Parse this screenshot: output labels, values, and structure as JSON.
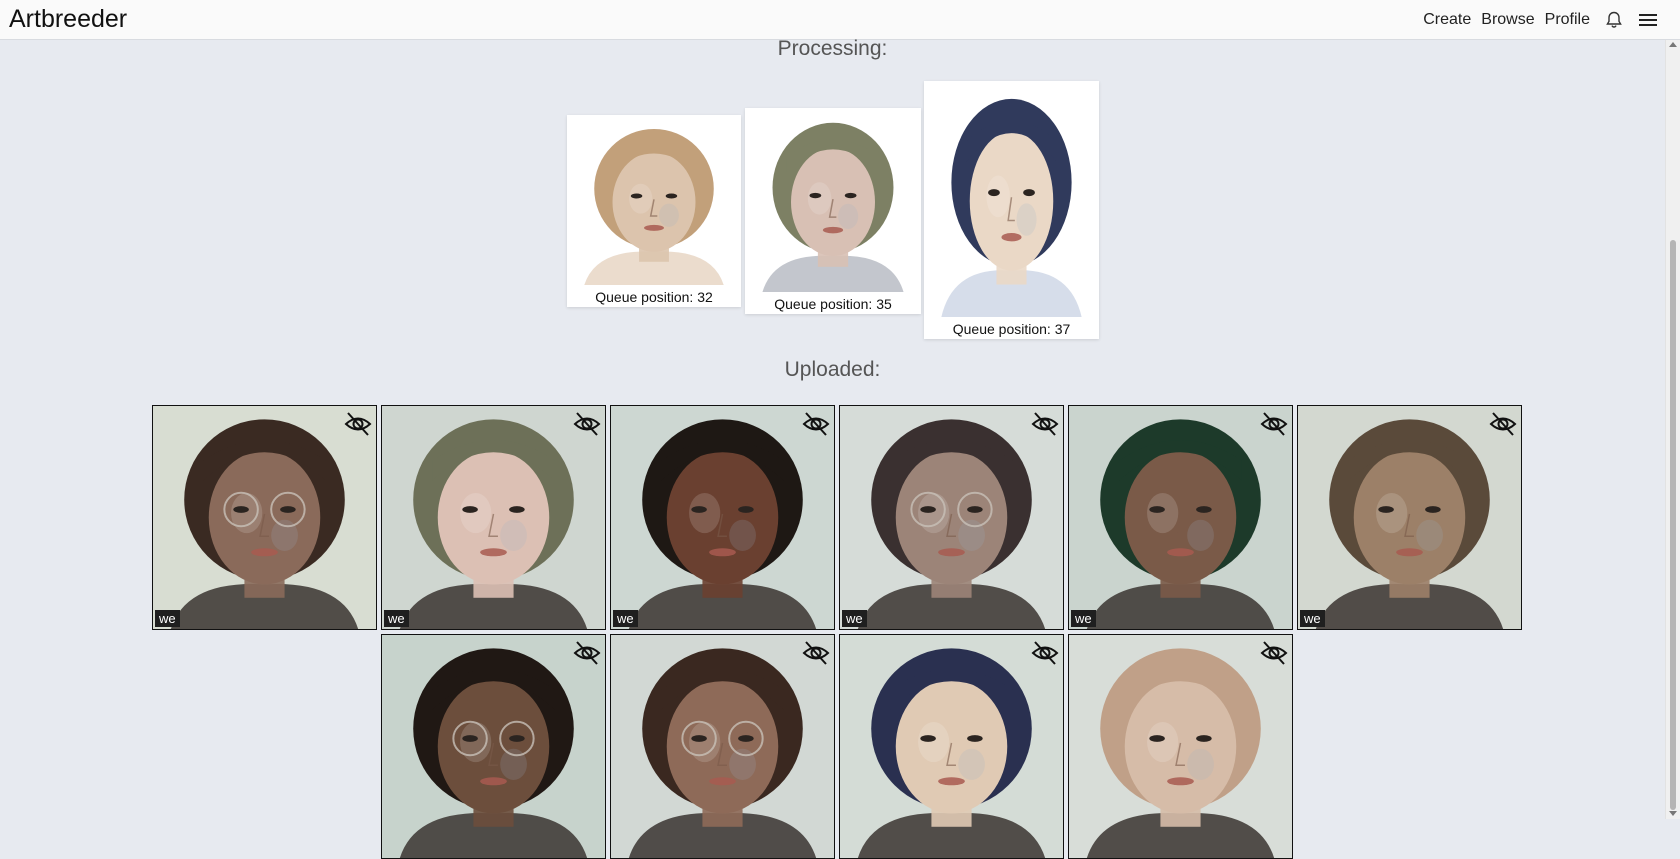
{
  "nav": {
    "brand": "Artbreeder",
    "links": [
      "Create",
      "Browse",
      "Profile"
    ],
    "icons": [
      "bell-icon",
      "hamburger-menu-icon"
    ]
  },
  "processing": {
    "title": "Processing:",
    "items": [
      {
        "queue_label": "Queue position: 32",
        "hair": "#c2a07a",
        "skin": "#dcc4ad",
        "tint": "#e8d6c4"
      },
      {
        "queue_label": "Queue position: 35",
        "hair": "#7d8064",
        "skin": "#d8c0b4",
        "tint": "#b8bcc4"
      },
      {
        "queue_label": "Queue position: 37",
        "hair": "#303a5c",
        "skin": "#ead8c6",
        "tint": "#cfd7e6"
      }
    ]
  },
  "uploaded": {
    "title": "Uploaded:",
    "badge_label": "we",
    "items": [
      {
        "hair": "#3a2a22",
        "skin": "#8a6a5a",
        "bg": "#d8ddd2",
        "glasses": true,
        "badge": true
      },
      {
        "hair": "#6d7058",
        "skin": "#dcc0b4",
        "bg": "#cfd6d0",
        "glasses": false,
        "badge": true
      },
      {
        "hair": "#1e1814",
        "skin": "#6a4030",
        "bg": "#cdd7d2",
        "glasses": false,
        "badge": true
      },
      {
        "hair": "#3a3030",
        "skin": "#9c8478",
        "bg": "#d6dcd8",
        "glasses": true,
        "badge": true
      },
      {
        "hair": "#1d3a2a",
        "skin": "#7a5a48",
        "bg": "#cad4ce",
        "glasses": false,
        "badge": true
      },
      {
        "hair": "#5a4a3a",
        "skin": "#9c8068",
        "bg": "#d3d8d0",
        "glasses": false,
        "badge": true
      },
      {
        "hair": "#201814",
        "skin": "#6c4e3c",
        "bg": "#c7d3cc",
        "glasses": true,
        "badge": false
      },
      {
        "hair": "#3a2820",
        "skin": "#8e6a58",
        "bg": "#d2d8d4",
        "glasses": true,
        "badge": false
      },
      {
        "hair": "#2a3050",
        "skin": "#e0cab4",
        "bg": "#d4dcd6",
        "glasses": false,
        "badge": false
      },
      {
        "hair": "#c0a088",
        "skin": "#d6bca8",
        "bg": "#d8ddd8",
        "glasses": false,
        "badge": false
      }
    ]
  }
}
